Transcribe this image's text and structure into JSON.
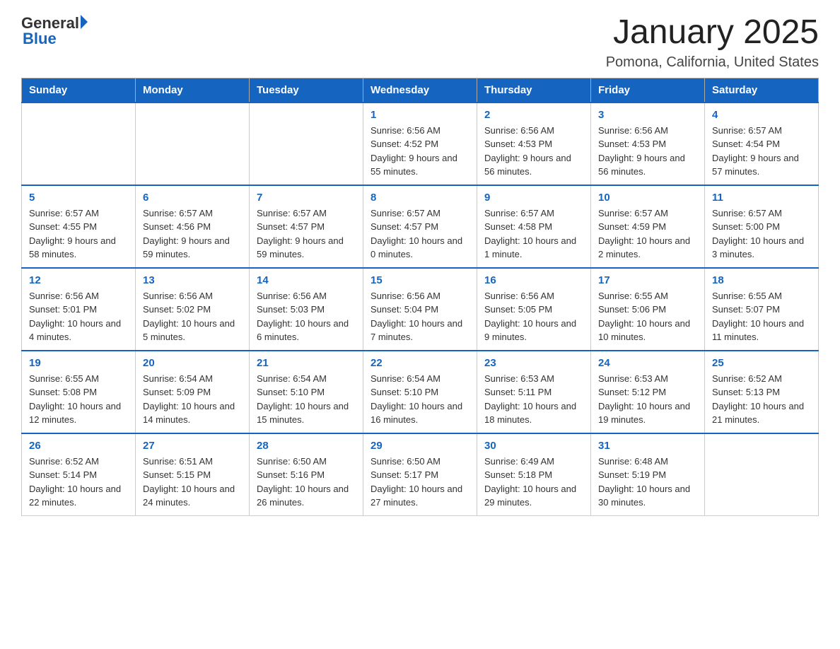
{
  "header": {
    "logo_general": "General",
    "logo_blue": "Blue",
    "title": "January 2025",
    "location": "Pomona, California, United States"
  },
  "days_of_week": [
    "Sunday",
    "Monday",
    "Tuesday",
    "Wednesday",
    "Thursday",
    "Friday",
    "Saturday"
  ],
  "weeks": [
    {
      "days": [
        {
          "num": "",
          "info": ""
        },
        {
          "num": "",
          "info": ""
        },
        {
          "num": "",
          "info": ""
        },
        {
          "num": "1",
          "info": "Sunrise: 6:56 AM\nSunset: 4:52 PM\nDaylight: 9 hours and 55 minutes."
        },
        {
          "num": "2",
          "info": "Sunrise: 6:56 AM\nSunset: 4:53 PM\nDaylight: 9 hours and 56 minutes."
        },
        {
          "num": "3",
          "info": "Sunrise: 6:56 AM\nSunset: 4:53 PM\nDaylight: 9 hours and 56 minutes."
        },
        {
          "num": "4",
          "info": "Sunrise: 6:57 AM\nSunset: 4:54 PM\nDaylight: 9 hours and 57 minutes."
        }
      ]
    },
    {
      "days": [
        {
          "num": "5",
          "info": "Sunrise: 6:57 AM\nSunset: 4:55 PM\nDaylight: 9 hours and 58 minutes."
        },
        {
          "num": "6",
          "info": "Sunrise: 6:57 AM\nSunset: 4:56 PM\nDaylight: 9 hours and 59 minutes."
        },
        {
          "num": "7",
          "info": "Sunrise: 6:57 AM\nSunset: 4:57 PM\nDaylight: 9 hours and 59 minutes."
        },
        {
          "num": "8",
          "info": "Sunrise: 6:57 AM\nSunset: 4:57 PM\nDaylight: 10 hours and 0 minutes."
        },
        {
          "num": "9",
          "info": "Sunrise: 6:57 AM\nSunset: 4:58 PM\nDaylight: 10 hours and 1 minute."
        },
        {
          "num": "10",
          "info": "Sunrise: 6:57 AM\nSunset: 4:59 PM\nDaylight: 10 hours and 2 minutes."
        },
        {
          "num": "11",
          "info": "Sunrise: 6:57 AM\nSunset: 5:00 PM\nDaylight: 10 hours and 3 minutes."
        }
      ]
    },
    {
      "days": [
        {
          "num": "12",
          "info": "Sunrise: 6:56 AM\nSunset: 5:01 PM\nDaylight: 10 hours and 4 minutes."
        },
        {
          "num": "13",
          "info": "Sunrise: 6:56 AM\nSunset: 5:02 PM\nDaylight: 10 hours and 5 minutes."
        },
        {
          "num": "14",
          "info": "Sunrise: 6:56 AM\nSunset: 5:03 PM\nDaylight: 10 hours and 6 minutes."
        },
        {
          "num": "15",
          "info": "Sunrise: 6:56 AM\nSunset: 5:04 PM\nDaylight: 10 hours and 7 minutes."
        },
        {
          "num": "16",
          "info": "Sunrise: 6:56 AM\nSunset: 5:05 PM\nDaylight: 10 hours and 9 minutes."
        },
        {
          "num": "17",
          "info": "Sunrise: 6:55 AM\nSunset: 5:06 PM\nDaylight: 10 hours and 10 minutes."
        },
        {
          "num": "18",
          "info": "Sunrise: 6:55 AM\nSunset: 5:07 PM\nDaylight: 10 hours and 11 minutes."
        }
      ]
    },
    {
      "days": [
        {
          "num": "19",
          "info": "Sunrise: 6:55 AM\nSunset: 5:08 PM\nDaylight: 10 hours and 12 minutes."
        },
        {
          "num": "20",
          "info": "Sunrise: 6:54 AM\nSunset: 5:09 PM\nDaylight: 10 hours and 14 minutes."
        },
        {
          "num": "21",
          "info": "Sunrise: 6:54 AM\nSunset: 5:10 PM\nDaylight: 10 hours and 15 minutes."
        },
        {
          "num": "22",
          "info": "Sunrise: 6:54 AM\nSunset: 5:10 PM\nDaylight: 10 hours and 16 minutes."
        },
        {
          "num": "23",
          "info": "Sunrise: 6:53 AM\nSunset: 5:11 PM\nDaylight: 10 hours and 18 minutes."
        },
        {
          "num": "24",
          "info": "Sunrise: 6:53 AM\nSunset: 5:12 PM\nDaylight: 10 hours and 19 minutes."
        },
        {
          "num": "25",
          "info": "Sunrise: 6:52 AM\nSunset: 5:13 PM\nDaylight: 10 hours and 21 minutes."
        }
      ]
    },
    {
      "days": [
        {
          "num": "26",
          "info": "Sunrise: 6:52 AM\nSunset: 5:14 PM\nDaylight: 10 hours and 22 minutes."
        },
        {
          "num": "27",
          "info": "Sunrise: 6:51 AM\nSunset: 5:15 PM\nDaylight: 10 hours and 24 minutes."
        },
        {
          "num": "28",
          "info": "Sunrise: 6:50 AM\nSunset: 5:16 PM\nDaylight: 10 hours and 26 minutes."
        },
        {
          "num": "29",
          "info": "Sunrise: 6:50 AM\nSunset: 5:17 PM\nDaylight: 10 hours and 27 minutes."
        },
        {
          "num": "30",
          "info": "Sunrise: 6:49 AM\nSunset: 5:18 PM\nDaylight: 10 hours and 29 minutes."
        },
        {
          "num": "31",
          "info": "Sunrise: 6:48 AM\nSunset: 5:19 PM\nDaylight: 10 hours and 30 minutes."
        },
        {
          "num": "",
          "info": ""
        }
      ]
    }
  ]
}
